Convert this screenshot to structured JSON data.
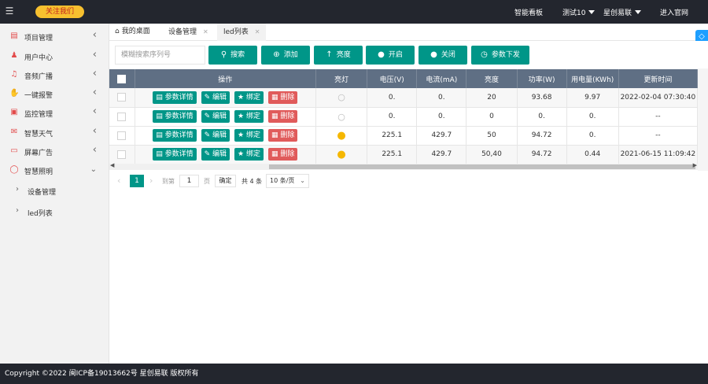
{
  "topbar": {
    "follow_label": "关注我们",
    "nav": [
      "智能看板",
      "测试10",
      "星创易联",
      "进入官网"
    ]
  },
  "sidebar": {
    "items": [
      {
        "label": "项目管理",
        "icon": "project-icon"
      },
      {
        "label": "用户中心",
        "icon": "users-icon"
      },
      {
        "label": "音频广播",
        "icon": "speaker-icon"
      },
      {
        "label": "一键报警",
        "icon": "alarm-icon"
      },
      {
        "label": "监控管理",
        "icon": "camera-icon"
      },
      {
        "label": "智慧天气",
        "icon": "weather-icon"
      },
      {
        "label": "屏幕广告",
        "icon": "monitor-icon"
      },
      {
        "label": "智慧照明",
        "icon": "bulb-icon"
      }
    ],
    "subitems": [
      {
        "label": "设备管理"
      },
      {
        "label": "led列表"
      }
    ]
  },
  "tabs": [
    {
      "label": "我的桌面"
    },
    {
      "label": "设备管理"
    },
    {
      "label": "led列表"
    }
  ],
  "toolbar": {
    "search_placeholder": "模糊搜索序列号",
    "buttons": [
      "搜索",
      "添加",
      "亮度",
      "开启",
      "关闭",
      "参数下发"
    ]
  },
  "table": {
    "headers": [
      "操作",
      "亮灯",
      "电压(V)",
      "电流(mA)",
      "亮度",
      "功率(W)",
      "用电量(KWh)",
      "更新时间"
    ],
    "action_labels": {
      "detail": "参数详情",
      "edit": "编辑",
      "bind": "绑定",
      "delete": "删除"
    },
    "rows": [
      {
        "lamp": "off",
        "voltage": "0.",
        "current": "0.",
        "brightness": "20",
        "power": "93.68",
        "energy": "9.97",
        "updated": "2022-02-04 07:30:40"
      },
      {
        "lamp": "off",
        "voltage": "0.",
        "current": "0.",
        "brightness": "0",
        "power": "0.",
        "energy": "0.",
        "updated": "--"
      },
      {
        "lamp": "on",
        "voltage": "225.1",
        "current": "429.7",
        "brightness": "50",
        "power": "94.72",
        "energy": "0.",
        "updated": "--"
      },
      {
        "lamp": "on",
        "voltage": "225.1",
        "current": "429.7",
        "brightness": "50,40",
        "power": "94.72",
        "energy": "0.44",
        "updated": "2021-06-15 11:09:42"
      }
    ]
  },
  "pager": {
    "current_page": "1",
    "goto_label": "到第",
    "goto_value": "1",
    "page_unit": "页",
    "confirm": "确定",
    "total": "共 4 条",
    "page_size": "10 条/页"
  },
  "footer": {
    "text": "Copyright ©2022 闽ICP备19013662号 星创易联 版权所有"
  },
  "colors": {
    "primary": "#009688",
    "danger": "#e05b5b",
    "header": "#23262e",
    "table_head": "#5f6f84"
  }
}
